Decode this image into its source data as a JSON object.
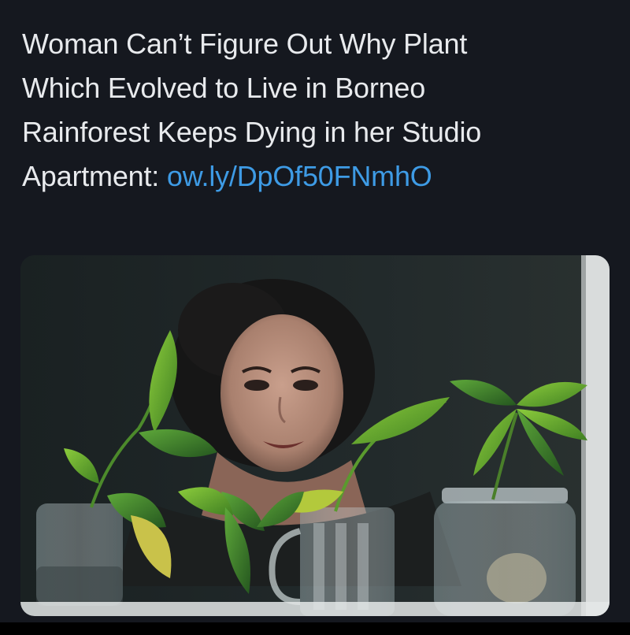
{
  "tweet": {
    "text_lines": [
      "Woman Can’t Figure Out Why Plant",
      "Which Evolved to Live in Borneo",
      "Rainforest Keeps Dying in her Studio",
      "Apartment: "
    ],
    "link_text": "ow.ly/DpOf50FNmhO"
  },
  "colors": {
    "background": "#15181f",
    "text": "#e8eaed",
    "link": "#3e9be5"
  },
  "media": {
    "kind": "photo",
    "subject": "woman-behind-potted-plants-in-glass-jars"
  }
}
